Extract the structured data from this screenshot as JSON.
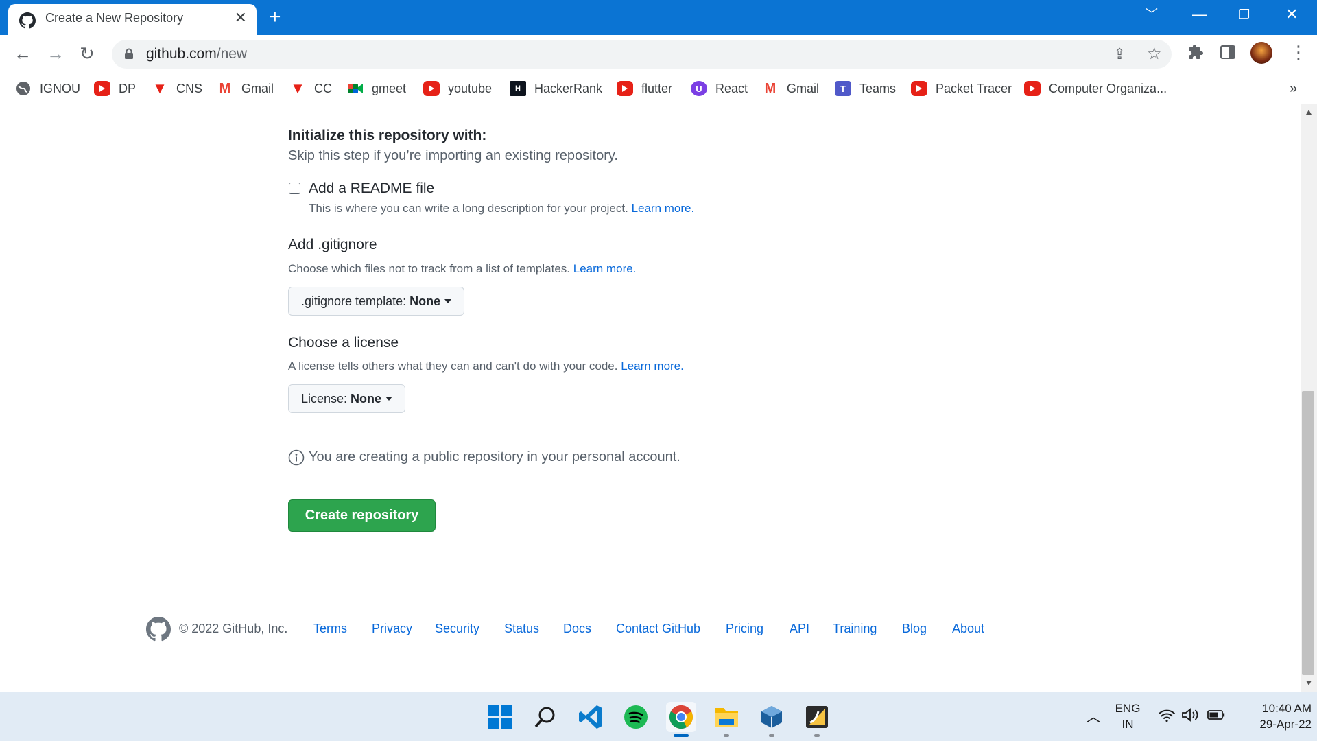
{
  "browser": {
    "tab_title": "Create a New Repository",
    "new_tab": "+",
    "url_host": "github.com",
    "url_path": "/new",
    "bookmarks": [
      "IGNOU",
      "DP",
      "CNS",
      "Gmail",
      "CC",
      "gmeet",
      "youtube",
      "HackerRank",
      "flutter",
      "React",
      "Gmail",
      "Teams",
      "Packet Tracer",
      "Computer Organiza..."
    ],
    "bookmarks_more": "»"
  },
  "init": {
    "heading": "Initialize this repository with:",
    "subtext": "Skip this step if you’re importing an existing repository.",
    "readme_label": "Add a README file",
    "readme_desc": "This is where you can write a long description for your project.",
    "readme_learn": "Learn more.",
    "readme_checked": false
  },
  "gitignore": {
    "heading": "Add .gitignore",
    "desc": "Choose which files not to track from a list of templates.",
    "learn": "Learn more.",
    "select_label": ".gitignore template:",
    "select_value": "None"
  },
  "license": {
    "heading": "Choose a license",
    "desc": "A license tells others what they can and can't do with your code.",
    "learn": "Learn more.",
    "select_label": "License:",
    "select_value": "None"
  },
  "notice": "You are creating a public repository in your personal account.",
  "create_button": "Create repository",
  "footer": {
    "copyright": "© 2022 GitHub, Inc.",
    "links": [
      "Terms",
      "Privacy",
      "Security",
      "Status",
      "Docs",
      "Contact GitHub",
      "Pricing",
      "API",
      "Training",
      "Blog",
      "About"
    ]
  },
  "taskbar": {
    "lang_top": "ENG",
    "lang_bottom": "IN",
    "time": "10:40 AM",
    "date": "29-Apr-22"
  },
  "colors": {
    "chrome_blue": "#0b74d3",
    "link": "#0969da",
    "create_green": "#2da44e"
  }
}
